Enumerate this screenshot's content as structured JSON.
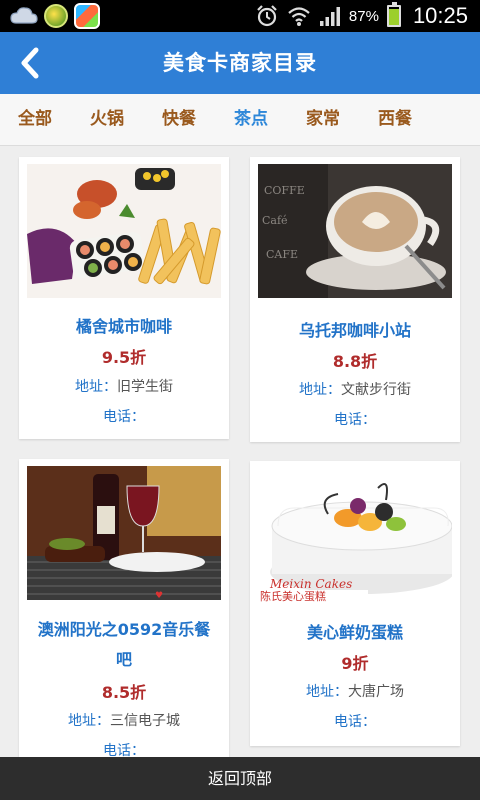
{
  "status_bar": {
    "battery_percent_text": "87%",
    "battery_level": 0.87,
    "time": "10:25",
    "icons": [
      "weather-cloud-icon",
      "game-ball-icon",
      "app-store-icon",
      "alarm-clock-icon",
      "wifi-icon",
      "signal-bars-icon",
      "battery-icon"
    ]
  },
  "header": {
    "title": "美食卡商家目录",
    "back_icon": "chevron-left-icon"
  },
  "tabs": [
    {
      "label": "全部",
      "active": false
    },
    {
      "label": "火锅",
      "active": false
    },
    {
      "label": "快餐",
      "active": false
    },
    {
      "label": "茶点",
      "active": true
    },
    {
      "label": "家常",
      "active": false
    },
    {
      "label": "西餐",
      "active": false
    }
  ],
  "merchants": [
    {
      "name": "橘舍城市咖啡",
      "discount": "9.5折",
      "address_label": "地址：",
      "address": "旧学生街",
      "phone_label": "电话：",
      "phone": "",
      "image": "sushi-fries-plate-photo"
    },
    {
      "name": "乌托邦咖啡小站",
      "discount": "8.8折",
      "address_label": "地址：",
      "address": "文献步行街",
      "phone_label": "电话：",
      "phone": "",
      "image": "latte-art-cup-photo"
    },
    {
      "name": "澳洲阳光之0592音乐餐",
      "name_line2": "吧",
      "discount": "8.5折",
      "address_label": "地址：",
      "address": "三信电子城",
      "phone_label": "电话：",
      "phone": "",
      "image": "steak-wine-photo"
    },
    {
      "name": "美心鲜奶蛋糕",
      "discount": "9折",
      "address_label": "地址：",
      "address": "大唐广场",
      "phone_label": "电话：",
      "phone": "",
      "image": "fruit-cake-photo",
      "image_watermark": "Meixin Cakes",
      "image_caption": "陈氏美心蛋糕"
    }
  ],
  "footer": {
    "back_to_top": "返回顶部"
  },
  "colors": {
    "header_bg": "#2f7fd6",
    "tab_text": "#9a5a1e",
    "tab_active": "#2d87d9",
    "merchant_name": "#2273c8",
    "discount": "#b02c2c",
    "footer_bg": "#2d2d2d"
  }
}
